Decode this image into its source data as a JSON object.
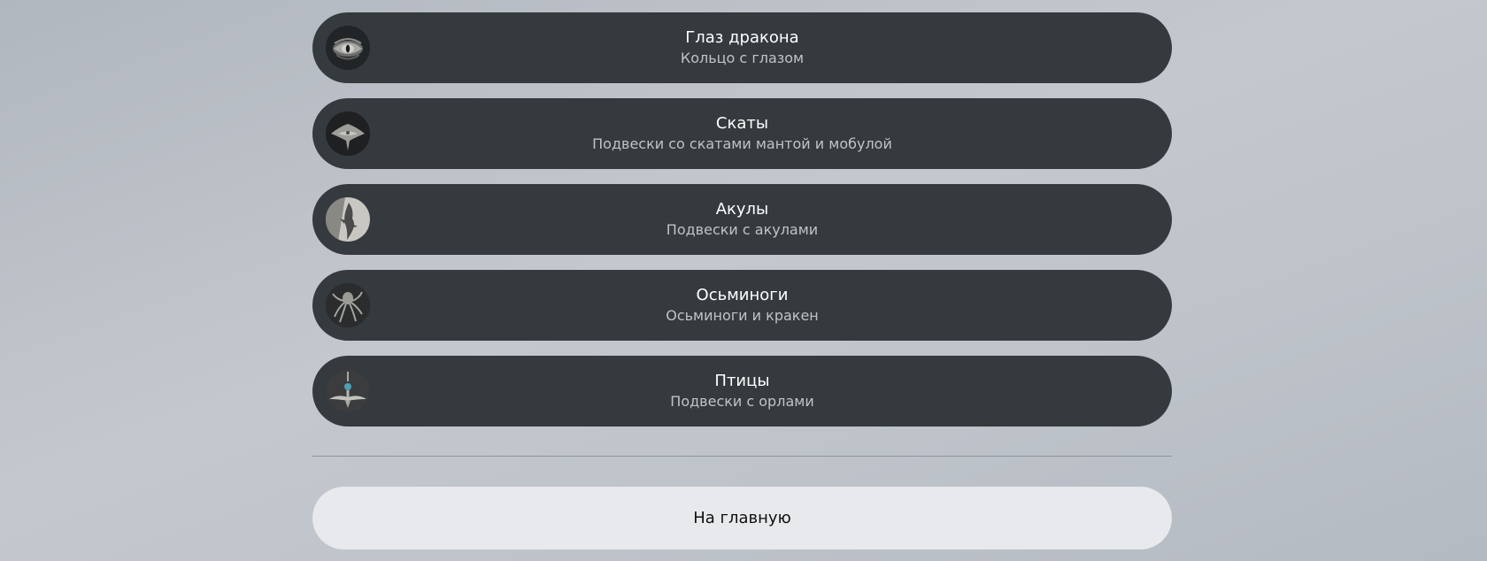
{
  "menu": {
    "items": [
      {
        "title": "Глаз дракона",
        "subtitle": "Кольцо с глазом",
        "icon": "dragon-eye-ring-icon"
      },
      {
        "title": "Скаты",
        "subtitle": "Подвески со скатами мантой и мобулой",
        "icon": "manta-ray-pendant-icon"
      },
      {
        "title": "Акулы",
        "subtitle": "Подвески с акулами",
        "icon": "shark-pendant-icon"
      },
      {
        "title": "Осьминоги",
        "subtitle": "Осьминоги и кракен",
        "icon": "octopus-pendant-icon"
      },
      {
        "title": "Птицы",
        "subtitle": "Подвески с орлами",
        "icon": "eagle-pendant-icon"
      }
    ]
  },
  "footer": {
    "home_label": "На главную"
  },
  "colors": {
    "item_background": "#353a3e",
    "home_button_background": "#e8e9ec",
    "divider": "#8d939a"
  }
}
